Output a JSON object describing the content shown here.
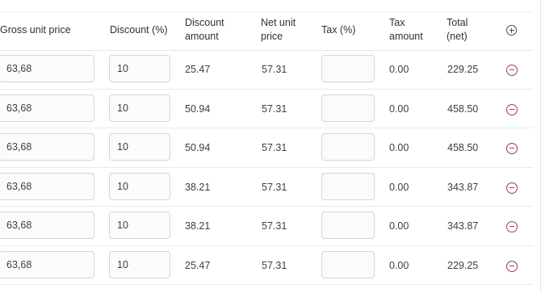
{
  "header": {
    "gross_unit_price": "Gross unit price",
    "discount_pct": "Discount (%)",
    "discount_amount": [
      "Discount",
      "amount"
    ],
    "net_unit_price": [
      "Net unit",
      "price"
    ],
    "tax_pct": "Tax (%)",
    "tax_amount": [
      "Tax",
      "amount"
    ],
    "total_net": [
      "Total",
      "(net)"
    ]
  },
  "icons": {
    "add": "add-circle-icon",
    "remove": "remove-circle-icon"
  },
  "colors": {
    "add_icon": "#2f5f2f",
    "remove_icon": "#a73a46"
  },
  "rows": [
    {
      "gross": "63,68",
      "discount": "10",
      "discount_amount": "25.47",
      "net": "57.31",
      "tax": "",
      "tax_amount": "0.00",
      "total": "229.25"
    },
    {
      "gross": "63,68",
      "discount": "10",
      "discount_amount": "50.94",
      "net": "57.31",
      "tax": "",
      "tax_amount": "0.00",
      "total": "458.50"
    },
    {
      "gross": "63,68",
      "discount": "10",
      "discount_amount": "50.94",
      "net": "57.31",
      "tax": "",
      "tax_amount": "0.00",
      "total": "458.50"
    },
    {
      "gross": "63,68",
      "discount": "10",
      "discount_amount": "38.21",
      "net": "57.31",
      "tax": "",
      "tax_amount": "0.00",
      "total": "343.87"
    },
    {
      "gross": "63,68",
      "discount": "10",
      "discount_amount": "38.21",
      "net": "57.31",
      "tax": "",
      "tax_amount": "0.00",
      "total": "343.87"
    },
    {
      "gross": "63,68",
      "discount": "10",
      "discount_amount": "25.47",
      "net": "57.31",
      "tax": "",
      "tax_amount": "0.00",
      "total": "229.25"
    }
  ]
}
